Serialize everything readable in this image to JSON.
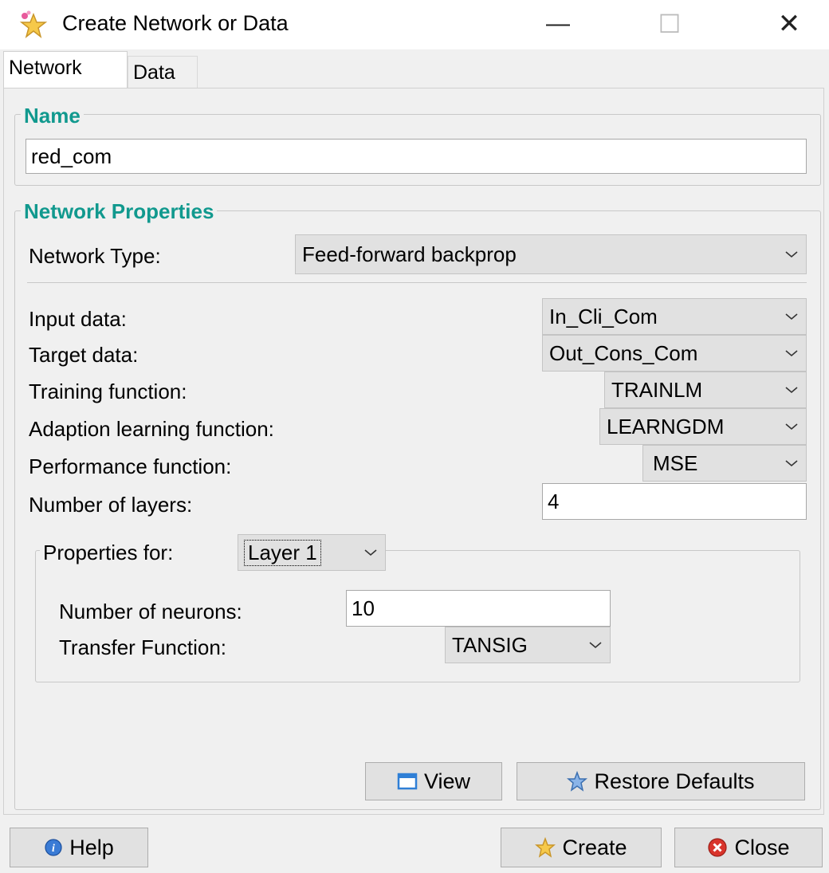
{
  "window": {
    "title": "Create Network or Data",
    "minimize_glyph": "—",
    "maximize_glyph": "☐",
    "close_glyph": "✕"
  },
  "tabs": [
    {
      "label": "Network",
      "active": true
    },
    {
      "label": "Data",
      "active": false
    }
  ],
  "name_group": {
    "title": "Name",
    "value": "red_com"
  },
  "props_group": {
    "title": "Network Properties",
    "network_type_label": "Network Type:",
    "network_type_value": "Feed-forward backprop",
    "input_label": "Input data:",
    "input_value": "In_Cli_Com",
    "target_label": "Target data:",
    "target_value": "Out_Cons_Com",
    "training_label": "Training function:",
    "training_value": "TRAINLM",
    "adaption_label": "Adaption learning function:",
    "adaption_value": "LEARNGDM",
    "performance_label": "Performance function:",
    "performance_value": "MSE",
    "layers_label": "Number of layers:",
    "layers_value": "4"
  },
  "layer_group": {
    "title": "Properties for:",
    "layer_value": "Layer 1",
    "neurons_label": "Number of neurons:",
    "neurons_value": "10",
    "transfer_label": "Transfer Function:",
    "transfer_value": "TANSIG"
  },
  "buttons": {
    "view": "View",
    "restore": "Restore Defaults",
    "help": "Help",
    "create": "Create",
    "close": "Close"
  },
  "icons": {
    "app": "star-wand-icon",
    "view": "window-icon",
    "restore": "star-icon",
    "help": "info-icon",
    "create": "star-icon",
    "close": "close-circle-icon"
  },
  "colors": {
    "group_title": "#11998e",
    "close_icon": "#d9342b",
    "view_icon": "#2f7fd6"
  }
}
